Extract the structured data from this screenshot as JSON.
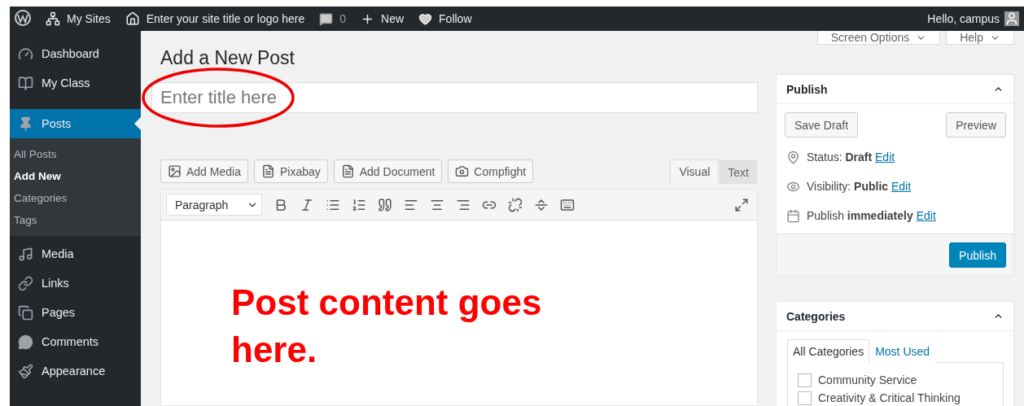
{
  "admin_bar": {
    "items": [
      {
        "kind": "logo"
      },
      {
        "kind": "sites",
        "label": "My Sites"
      },
      {
        "kind": "home",
        "label": "Enter your site title or logo here"
      },
      {
        "kind": "comments",
        "label": "0"
      },
      {
        "kind": "new",
        "label": "New"
      },
      {
        "kind": "follow",
        "label": "Follow"
      }
    ],
    "greeting": "Hello, campus"
  },
  "sidebar": {
    "items": [
      {
        "label": "Dashboard",
        "selected": false
      },
      {
        "label": "My Class",
        "selected": false
      },
      {
        "label": "Posts",
        "selected": true,
        "children": [
          {
            "label": "All Posts",
            "selected": false
          },
          {
            "label": "Add New",
            "selected": true
          },
          {
            "label": "Categories",
            "selected": false
          },
          {
            "label": "Tags",
            "selected": false
          }
        ]
      },
      {
        "label": "Media",
        "selected": false
      },
      {
        "label": "Links",
        "selected": false
      },
      {
        "label": "Pages",
        "selected": false
      },
      {
        "label": "Comments",
        "selected": false
      },
      {
        "label": "Appearance",
        "selected": false
      }
    ]
  },
  "screen_tabs": [
    "Screen Options",
    "Help"
  ],
  "page_title": "Add a New Post",
  "title_field": {
    "placeholder": "Enter title here"
  },
  "media_buttons": [
    "Add Media",
    "Pixabay",
    "Add Document",
    "Compfight"
  ],
  "editor_tabs": [
    {
      "label": "Visual",
      "selected": true
    },
    {
      "label": "Text",
      "selected": false
    }
  ],
  "format_select": "Paragraph",
  "annotation": {
    "text": "Post content goes here."
  },
  "publish": {
    "title": "Publish",
    "save_draft": "Save Draft",
    "preview": "Preview",
    "rows": [
      {
        "text": "Status: **Draft**",
        "link": "Edit"
      },
      {
        "text": "Visibility: **Public**",
        "link": "Edit"
      },
      {
        "text": "Publish **immediately**",
        "link": "Edit"
      }
    ],
    "button": "Publish"
  },
  "categories": {
    "title": "Categories",
    "tabs": [
      {
        "label": "All Categories",
        "selected": true
      },
      {
        "label": "Most Used",
        "selected": false
      }
    ],
    "items": [
      {
        "label": "Community Service",
        "checked": false
      },
      {
        "label": "Creativity & Critical Thinking",
        "checked": false
      }
    ]
  }
}
